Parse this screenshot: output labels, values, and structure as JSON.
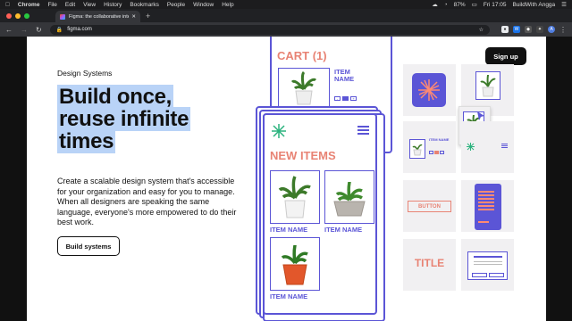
{
  "menubar": {
    "apple": "",
    "app": "Chrome",
    "items": [
      "File",
      "Edit",
      "View",
      "History",
      "Bookmarks",
      "People",
      "Window",
      "Help"
    ],
    "battery": "87%",
    "clock": "Fri 17:05",
    "user": "BuildWith Angga"
  },
  "browser": {
    "tab_title": "Figma: the collaborative interf",
    "url": "figma.com",
    "profile": "A"
  },
  "page": {
    "eyebrow": "Design Systems",
    "headline": [
      "Build once,",
      "reuse infinite",
      "times"
    ],
    "description": "Create a scalable design system that's accessible for your organization and easy for you to manage. When all designers are speaking the same language, everyone's more empowered to do their best work.",
    "cta": "Build systems",
    "signup": "Sign up"
  },
  "mockup": {
    "cart_title": "CART (1)",
    "item_name": "ITEM NAME",
    "new_items": "NEW ITEMS",
    "button_label": "BUTTON",
    "title_label": "TITLE",
    "colors": {
      "accent": "#5b55d6",
      "coral": "#e88374",
      "tile": "#f1f0f2"
    }
  }
}
